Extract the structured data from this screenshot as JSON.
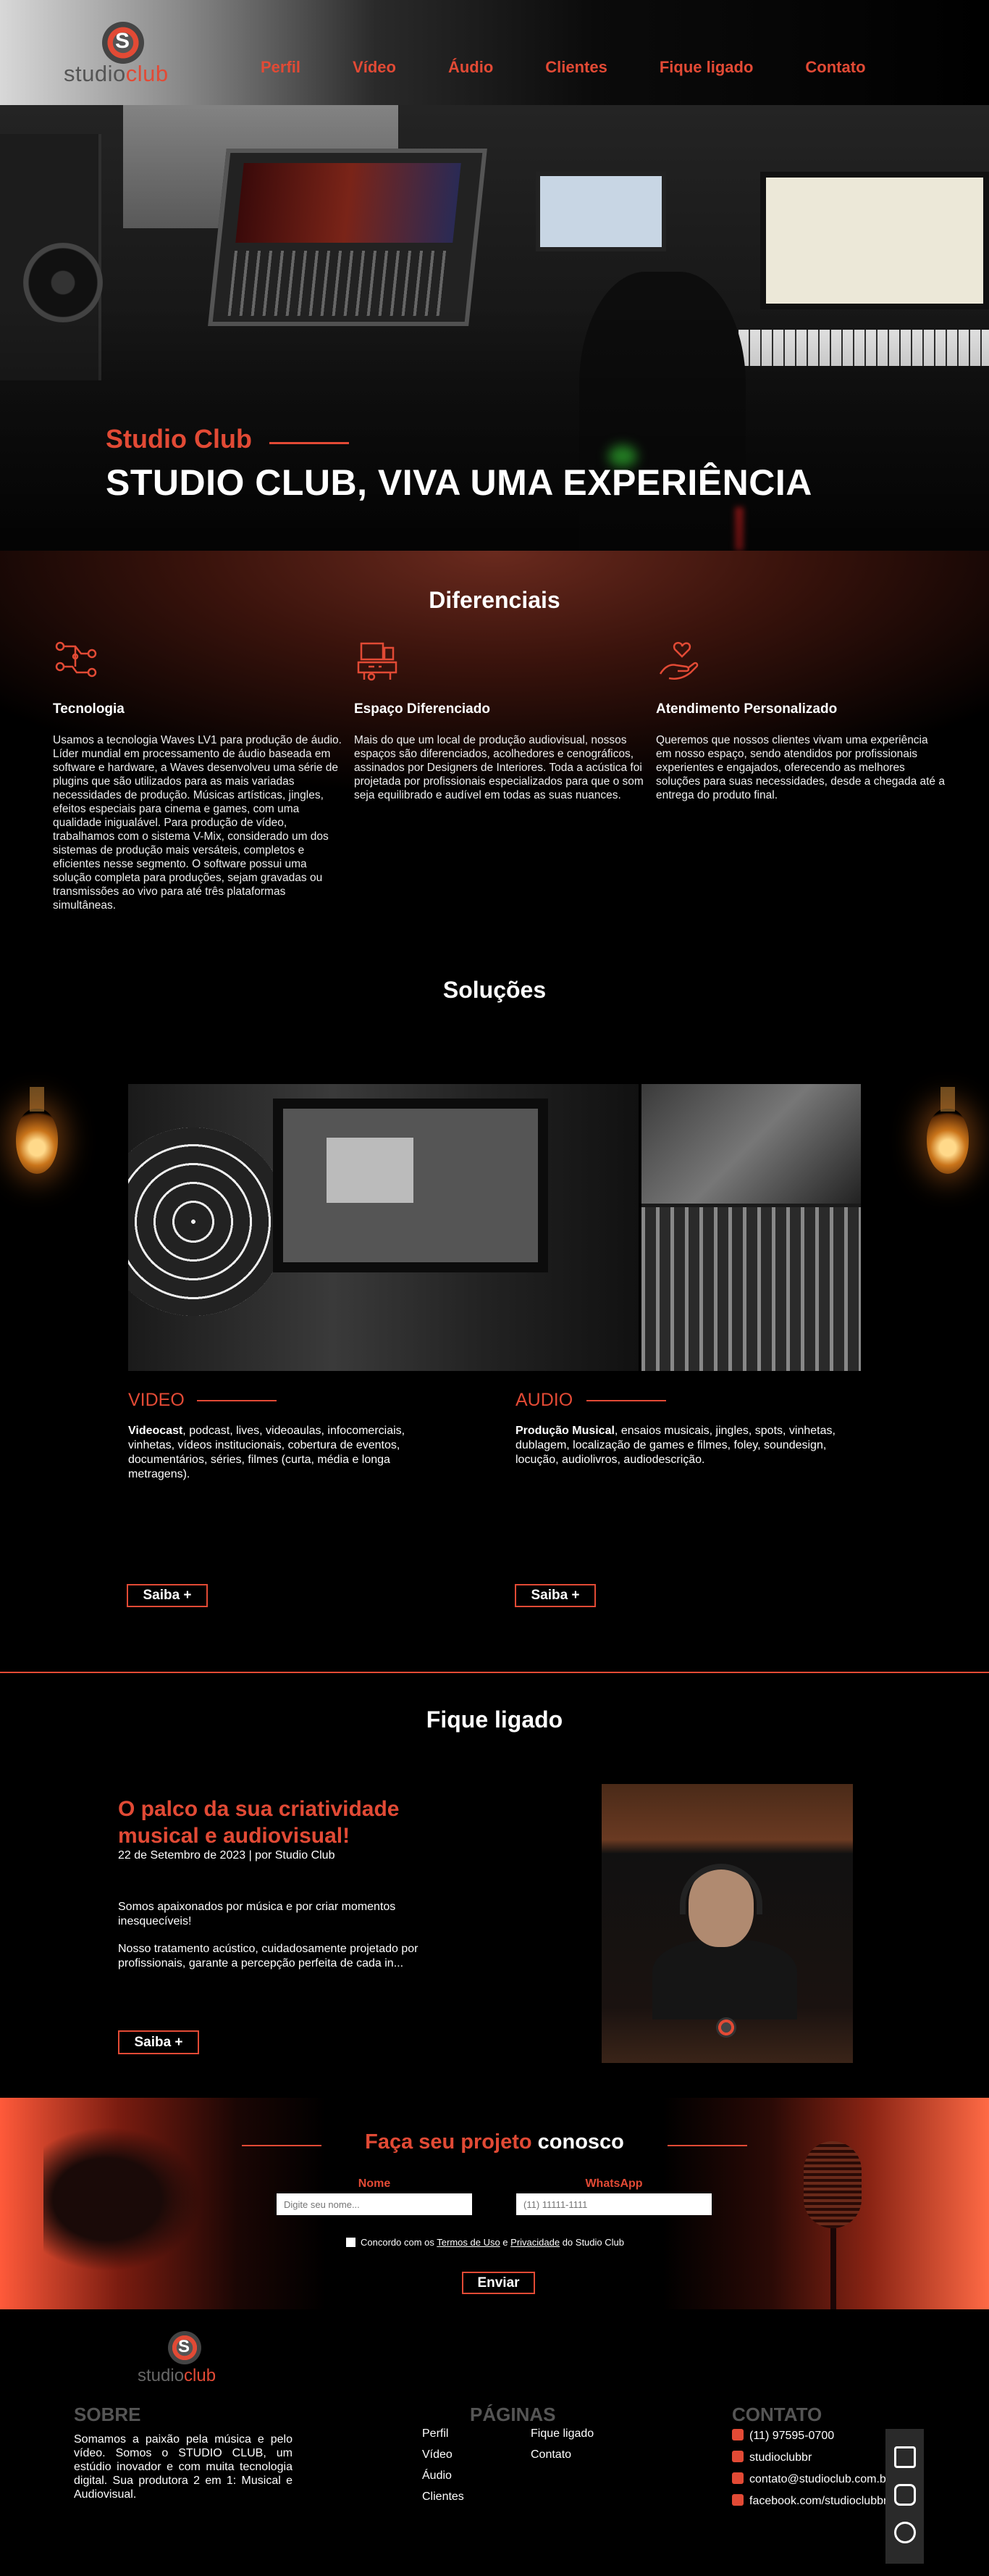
{
  "nav": {
    "logo": {
      "s_letter": "S",
      "brand_part1": "studio",
      "brand_part2": "club"
    },
    "items": [
      "Perfil",
      "Vídeo",
      "Áudio",
      "Clientes",
      "Fique ligado",
      "Contato"
    ]
  },
  "hero": {
    "kicker": "Studio Club",
    "title": "STUDIO CLUB, VIVA UMA EXPERIÊNCIA"
  },
  "diferenciais": {
    "title": "Diferenciais",
    "items": [
      {
        "icon": "network-icon",
        "title": "Tecnologia",
        "text": "Usamos a tecnologia Waves LV1 para produção de áudio. Líder mundial em processamento de áudio baseada em software e hardware, a Waves desenvolveu uma série de plugins que são utilizados para as mais variadas necessidades de produção. Músicas artísticas, jingles, efeitos especiais para cinema e games, com uma qualidade inigualável. Para produção de vídeo, trabalhamos com o sistema V-Mix, considerado um dos sistemas de produção mais versáteis, completos e eficientes nesse segmento. O software possui uma solução completa para produções, sejam gravadas ou transmissões ao vivo para até três plataformas simultâneas."
      },
      {
        "icon": "studio-icon",
        "title": "Espaço Diferenciado",
        "text": "Mais do que um local de produção audiovisual, nossos espaços são diferenciados, acolhedores e cenográficos, assinados por Designers de Interiores. Toda a acústica foi projetada por profissionais especializados para que o som seja equilibrado e audível em todas as suas nuances."
      },
      {
        "icon": "hand-heart-icon",
        "title": "Atendimento Personalizado",
        "text": "Queremos que nossos clientes vivam uma experiência em nosso espaço, sendo atendidos por profissionais experientes e engajados, oferecendo as melhores soluções para suas necessidades, desde a chegada até a entrega do produto final."
      }
    ]
  },
  "solucoes": {
    "title": "Soluções",
    "video": {
      "heading": "VIDEO",
      "lead": "Videocast",
      "text": ", podcast, lives, videoaulas, infocomerciais, vinhetas, vídeos institucionais, cobertura de eventos, documentários, séries, filmes (curta, média e longa metragens).",
      "button": "Saiba +"
    },
    "audio": {
      "heading": "AUDIO",
      "lead": "Produção Musical",
      "text": ", ensaios musicais, jingles, spots, vinhetas, dublagem, localização de games e filmes, foley, soundesign, locução, audiolivros, audiodescrição.",
      "button": "Saiba +"
    }
  },
  "fique_ligado": {
    "title": "Fique ligado",
    "post": {
      "title": "O palco da sua criatividade musical e audiovisual!",
      "meta": "22 de Setembro de 2023 | por Studio Club",
      "p1": "Somos apaixonados por música e por criar momentos inesquecíveis!",
      "p2": "Nosso tratamento acústico, cuidadosamente projetado por profissionais, garante a percepção perfeita de cada in...",
      "button": "Saiba +"
    }
  },
  "contact": {
    "title_accent": "Faça seu projeto",
    "title_rest": " conosco",
    "name_label": "Nome",
    "name_placeholder": "Digite seu nome...",
    "whatsapp_label": "WhatsApp",
    "whatsapp_placeholder": "(11) 11111-1111",
    "consent": {
      "pre": "Concordo com os ",
      "terms": "Termos de Uso",
      "mid": " e ",
      "privacy": "Privacidade",
      "post": " do Studio Club"
    },
    "submit": "Enviar"
  },
  "footer": {
    "logo": {
      "s_letter": "S",
      "brand_part1": "studio",
      "brand_part2": "club"
    },
    "sobre": {
      "title": "SOBRE",
      "text": "Somamos a paixão pela música e pelo vídeo. Somos o STUDIO CLUB, um estúdio inovador e com muita tecnologia digital. Sua produtora 2 em 1: Musical e Audiovisual."
    },
    "paginas": {
      "title": "PÁGINAS",
      "col1": [
        "Perfil",
        "Vídeo",
        "Áudio",
        "Clientes"
      ],
      "col2": [
        "Fique ligado",
        "Contato"
      ]
    },
    "contato": {
      "title": "CONTATO",
      "items": [
        {
          "icon": "whatsapp-icon",
          "text": "(11) 97595-0700"
        },
        {
          "icon": "instagram-icon",
          "text": "studioclubbr"
        },
        {
          "icon": "email-icon",
          "text": "contato@studioclub.com.br"
        },
        {
          "icon": "facebook-icon",
          "text": "facebook.com/studioclubbr"
        }
      ]
    }
  },
  "floating_bar": {
    "icons": [
      "mail-open-icon",
      "instagram-icon",
      "whatsapp-icon"
    ]
  },
  "colors": {
    "accent": "#e24a35",
    "background": "#000000",
    "muted": "#555555"
  }
}
